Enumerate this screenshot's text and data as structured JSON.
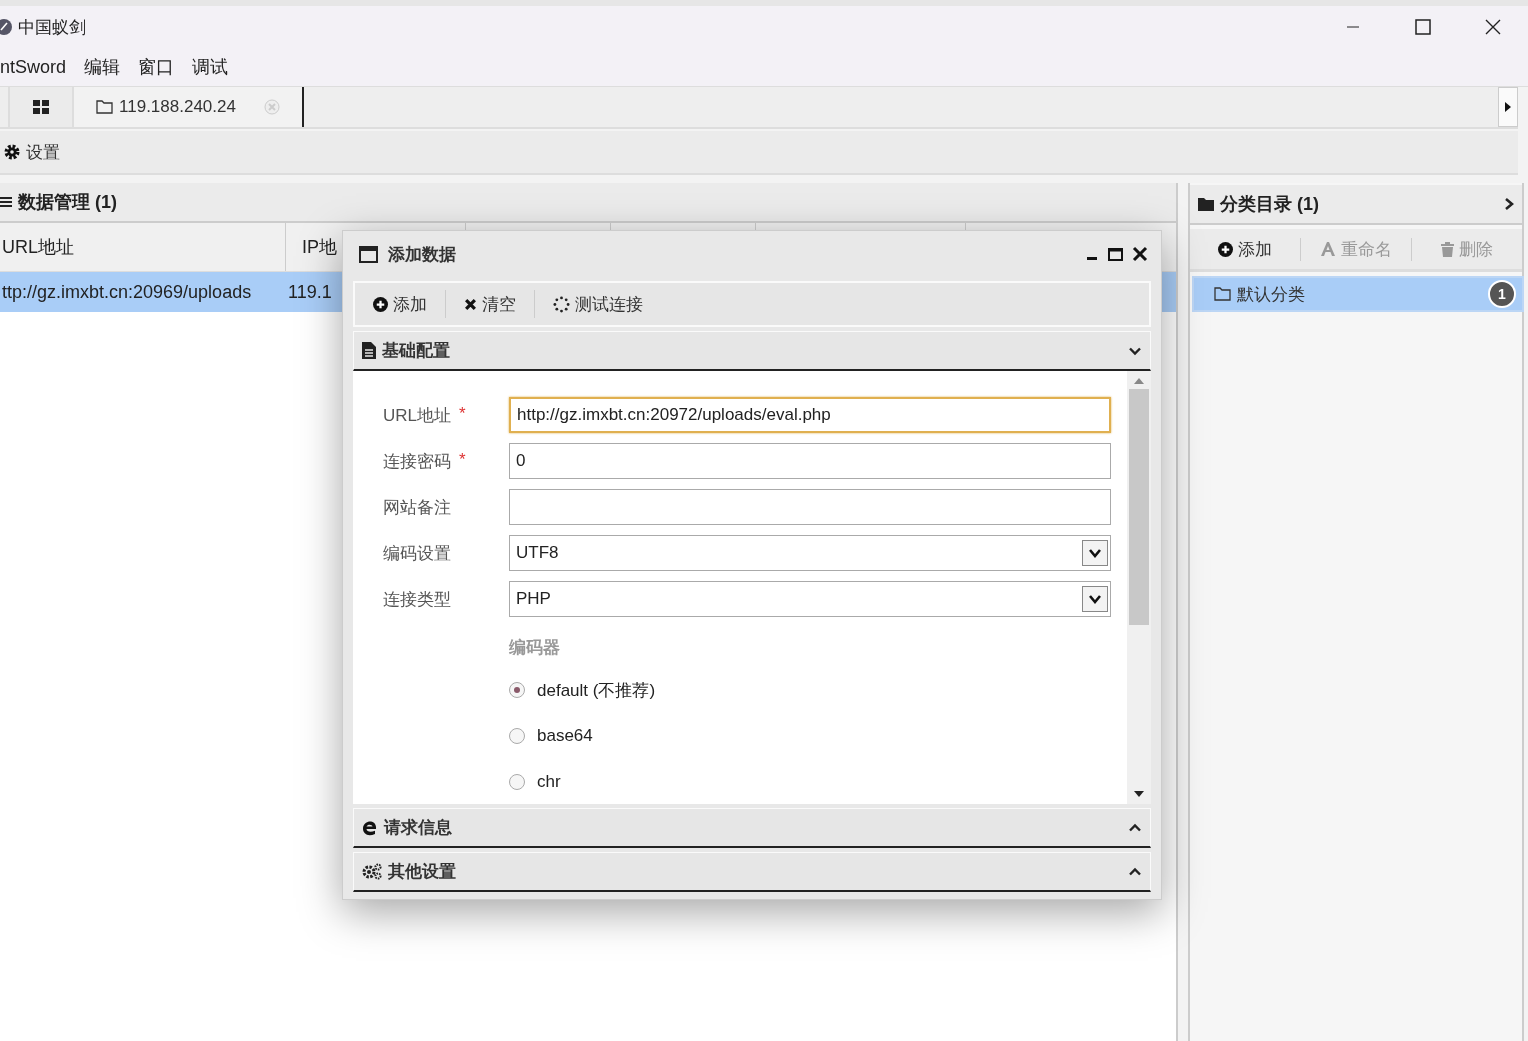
{
  "window": {
    "title": "中国蚁剑"
  },
  "menu": [
    {
      "label": "ntSword"
    },
    {
      "label": "编辑"
    },
    {
      "label": "窗口"
    },
    {
      "label": "调试"
    }
  ],
  "tabs": [
    {
      "kind": "home",
      "selected": false
    },
    {
      "kind": "host",
      "label": "119.188.240.24",
      "selected": true
    }
  ],
  "toolbar": {
    "settings": "设置"
  },
  "data_panel": {
    "title": "数据管理 (1)",
    "columns": [
      "URL地址",
      "IP地"
    ],
    "rows": [
      {
        "cells": [
          "ttp://gz.imxbt.cn:20969/uploads",
          "119.1"
        ],
        "selected": true
      }
    ]
  },
  "category_panel": {
    "title": "分类目录 (1)",
    "actions": [
      {
        "kind": "add",
        "label": "添加",
        "disabled": false
      },
      {
        "kind": "rename",
        "label": "重命名",
        "disabled": true
      },
      {
        "kind": "delete",
        "label": "删除",
        "disabled": true
      }
    ],
    "items": [
      {
        "label": "默认分类",
        "count": "1",
        "selected": true
      }
    ]
  },
  "dialog": {
    "title": "添加数据",
    "actions": [
      {
        "kind": "add",
        "label": "添加"
      },
      {
        "kind": "clear",
        "label": "清空"
      },
      {
        "kind": "test",
        "label": "测试连接"
      }
    ],
    "sections": [
      {
        "kind": "basic",
        "title": "基础配置",
        "expanded": true
      },
      {
        "kind": "request",
        "title": "请求信息",
        "expanded": false
      },
      {
        "kind": "other",
        "title": "其他设置",
        "expanded": false
      }
    ],
    "fields": [
      {
        "kind": "text",
        "label": "URL地址",
        "required_mark": "*",
        "value": "http://gz.imxbt.cn:20972/uploads/eval.php",
        "focused": true
      },
      {
        "kind": "text",
        "label": "连接密码",
        "required_mark": "*",
        "value": "0",
        "focused": false
      },
      {
        "kind": "text",
        "label": "网站备注",
        "focused": false
      },
      {
        "kind": "select",
        "label": "编码设置",
        "value": "UTF8"
      },
      {
        "kind": "select",
        "label": "连接类型",
        "value": "PHP"
      }
    ],
    "encoder": {
      "label": "编码器",
      "options": [
        {
          "label": "default (不推荐)",
          "selected": true
        },
        {
          "label": "base64",
          "selected": false
        },
        {
          "label": "chr",
          "selected": false
        }
      ]
    }
  }
}
